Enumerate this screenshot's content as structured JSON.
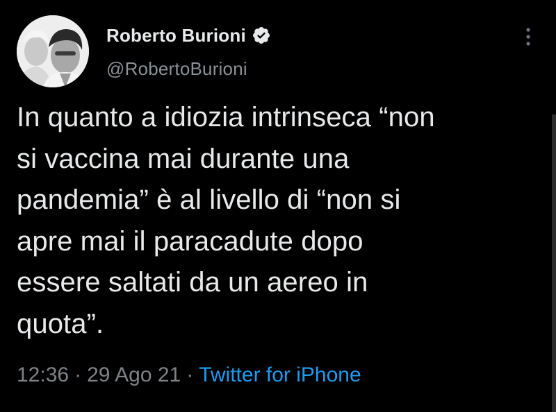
{
  "author": {
    "display_name": "Roberto Burioni",
    "handle": "@RobertoBurioni",
    "verified": true,
    "avatar_icon": "profile-photo"
  },
  "tweet": {
    "text": "In quanto a idiozia intrinseca “non\nsi vaccina mai durante una\npandemia” è al livello di “non si\napre mai il paracadute dopo\nessere saltati da un aereo in\nquota”.",
    "time": "12:36",
    "date": "29 Ago 21",
    "separator": "·",
    "source": "Twitter for iPhone"
  },
  "icons": {
    "verified": "verified-badge-icon",
    "more": "more-vertical-icon"
  },
  "colors": {
    "background": "#000000",
    "text": "#e7e9ea",
    "secondary_text": "#8b9196",
    "link": "#1d9bf0"
  }
}
